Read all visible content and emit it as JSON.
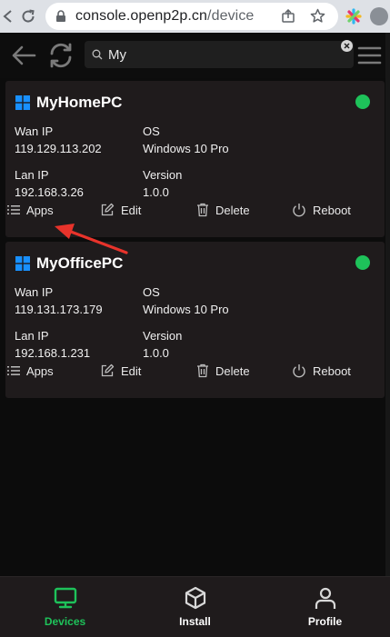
{
  "browser": {
    "url_host": "console.openp2p.cn",
    "url_path": "/device"
  },
  "toolbar": {
    "search_value": "My",
    "icons": [
      "back-arrow-icon",
      "refresh-icon",
      "search-icon",
      "clear-icon",
      "menu-icon"
    ]
  },
  "devices": [
    {
      "name": "MyHomePC",
      "status_color": "#1ec25a",
      "wan_ip_label": "Wan IP",
      "wan_ip": "119.129.113.202",
      "os_label": "OS",
      "os": "Windows 10 Pro",
      "lan_ip_label": "Lan IP",
      "lan_ip": "192.168.3.26",
      "version_label": "Version",
      "version": "1.0.0",
      "actions": {
        "apps": "Apps",
        "edit": "Edit",
        "delete": "Delete",
        "reboot": "Reboot"
      }
    },
    {
      "name": "MyOfficePC",
      "status_color": "#1ec25a",
      "wan_ip_label": "Wan IP",
      "wan_ip": "119.131.173.179",
      "os_label": "OS",
      "os": "Windows 10 Pro",
      "lan_ip_label": "Lan IP",
      "lan_ip": "192.168.1.231",
      "version_label": "Version",
      "version": "1.0.0",
      "actions": {
        "apps": "Apps",
        "edit": "Edit",
        "delete": "Delete",
        "reboot": "Reboot"
      }
    }
  ],
  "bottom_nav": {
    "items": [
      {
        "label": "Devices",
        "icon": "monitor-icon",
        "active": true
      },
      {
        "label": "Install",
        "icon": "box-icon",
        "active": false
      },
      {
        "label": "Profile",
        "icon": "person-icon",
        "active": false
      }
    ],
    "active_color": "#1ec25a",
    "inactive_color": "#ffffff"
  },
  "colors": {
    "accent": "#1ec25a",
    "card": "#1f1b1c",
    "annotation_arrow": "#e8332b"
  }
}
